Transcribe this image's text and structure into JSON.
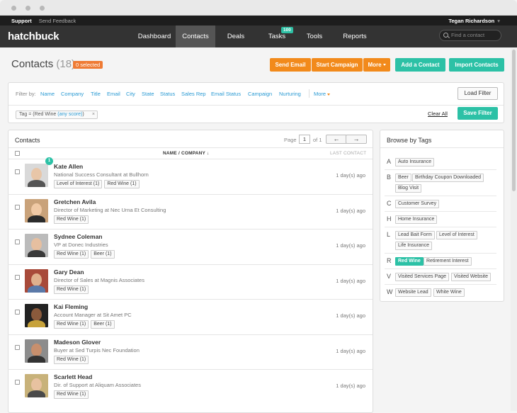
{
  "topbar": {
    "support": "Support",
    "feedback": "Send Feedback",
    "user": "Tegan Richardson",
    "user_caret": "▾"
  },
  "nav": {
    "logo": "hatchbuck",
    "items": [
      {
        "label": "Dashboard",
        "active": false
      },
      {
        "label": "Contacts",
        "active": true
      },
      {
        "label": "Deals",
        "active": false
      },
      {
        "label": "Tasks",
        "active": false,
        "badge": "100"
      },
      {
        "label": "Tools",
        "active": false
      },
      {
        "label": "Reports",
        "active": false
      }
    ],
    "search_placeholder": "Find a contact"
  },
  "page": {
    "title": "Contacts",
    "count": "(18)",
    "selected": "0 selected"
  },
  "actions": {
    "send_email": "Send Email",
    "start_campaign": "Start Campaign",
    "more": "More",
    "add_contact": "Add a Contact",
    "import_contacts": "Import Contacts"
  },
  "filters": {
    "label": "Filter by:",
    "links": [
      "Name",
      "Company",
      "Title",
      "Email",
      "City",
      "State",
      "Status",
      "Sales Rep",
      "Email Status",
      "Campaign",
      "Nurturing"
    ],
    "more": "More",
    "load_filter": "Load Filter",
    "active_chip_prefix": "Tag = (Red Wine",
    "active_chip_score": "(any score)",
    "active_chip_suffix": ")",
    "chip_close": "×",
    "clear_all": "Clear All",
    "save_filter": "Save Filter"
  },
  "contacts_panel": {
    "title": "Contacts",
    "page_label": "Page",
    "page": "1",
    "of": "of 1",
    "prev": "←",
    "next": "→",
    "col_name": "NAME / COMPANY ↓",
    "col_last": "LAST CONTACT"
  },
  "contacts": [
    {
      "name": "Kate Allen",
      "role": "National Success Consultant at Bullhorn",
      "tags": [
        "Level of Interest (1)",
        "Red Wine (1)"
      ],
      "last": "1 day(s) ago",
      "badge": "1"
    },
    {
      "name": "Gretchen Avila",
      "role": "Director of Marketing at Nec Urna Et Consulting",
      "tags": [
        "Red Wine (1)"
      ],
      "last": "1 day(s) ago"
    },
    {
      "name": "Sydnee Coleman",
      "role": "VP at Donec Industries",
      "tags": [
        "Red Wine (1)",
        "Beer (1)"
      ],
      "last": "1 day(s) ago"
    },
    {
      "name": "Gary Dean",
      "role": "Director of Sales at Magnis Associates",
      "tags": [
        "Red Wine (1)"
      ],
      "last": "1 day(s) ago"
    },
    {
      "name": "Kai Fleming",
      "role": "Account Manager at Sit Amet PC",
      "tags": [
        "Red Wine (1)",
        "Beer (1)"
      ],
      "last": "1 day(s) ago"
    },
    {
      "name": "Madeson Glover",
      "role": "Buyer at Sed Turpis Nec Foundation",
      "tags": [
        "Red Wine (1)"
      ],
      "last": "1 day(s) ago"
    },
    {
      "name": "Scarlett Head",
      "role": "Dir. of Support at Aliquam Associates",
      "tags": [
        "Red Wine (1)"
      ],
      "last": "1 day(s) ago"
    }
  ],
  "browse": {
    "title": "Browse by Tags",
    "groups": [
      {
        "letter": "A",
        "tags": [
          "Auto Insurance"
        ]
      },
      {
        "letter": "B",
        "tags": [
          "Beer",
          "Birthday Coupon Downloaded",
          "Blog Visit"
        ]
      },
      {
        "letter": "C",
        "tags": [
          "Customer Survey"
        ]
      },
      {
        "letter": "H",
        "tags": [
          "Home Insurance"
        ]
      },
      {
        "letter": "L",
        "tags": [
          "Lead Bait Form",
          "Level of Interest",
          "Life Insurance"
        ]
      },
      {
        "letter": "R",
        "tags": [
          "Red Wine",
          "Retirement Interest"
        ],
        "selected": "Red Wine"
      },
      {
        "letter": "V",
        "tags": [
          "Visited Services Page",
          "Visited Website"
        ]
      },
      {
        "letter": "W",
        "tags": [
          "Website Lead",
          "White Wine"
        ]
      }
    ]
  },
  "colors": {
    "orange": "#f28a1b",
    "teal": "#2cc1a6",
    "link": "#2a9ad3",
    "nav": "#333333"
  }
}
